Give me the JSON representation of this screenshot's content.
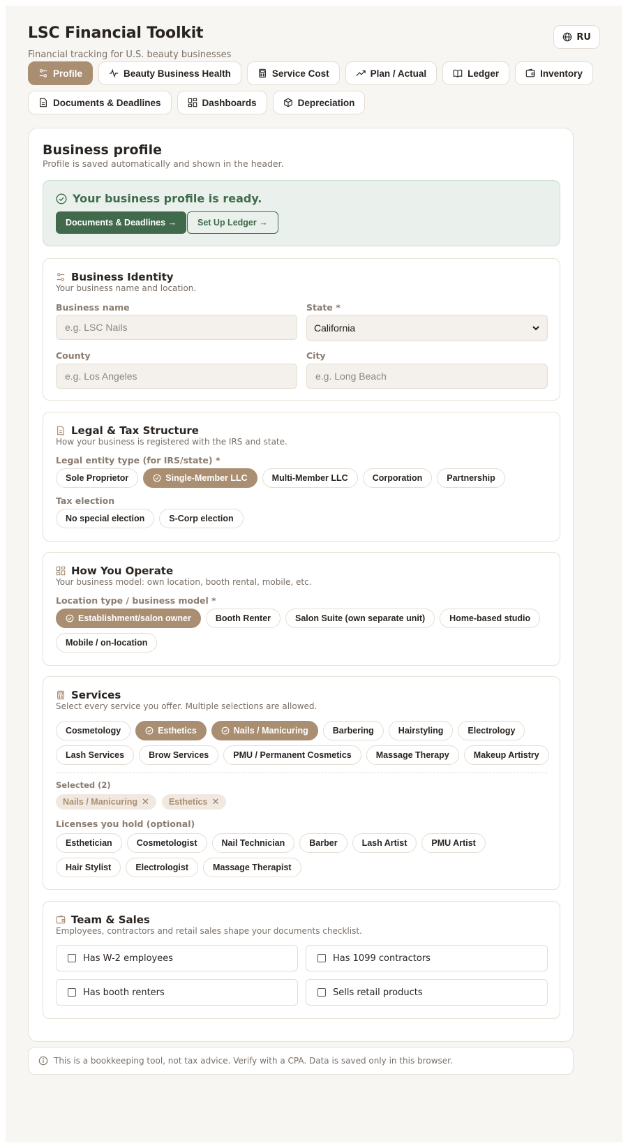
{
  "header": {
    "title": "LSC Financial Toolkit",
    "subtitle": "Financial tracking for U.S. beauty businesses",
    "lang_button": "RU"
  },
  "nav": {
    "row1": [
      {
        "label": "Profile",
        "icon": "sliders-icon",
        "active": true
      },
      {
        "label": "Beauty Business Health",
        "icon": "pulse-icon"
      },
      {
        "label": "Service Cost",
        "icon": "calculator-icon"
      },
      {
        "label": "Plan / Actual",
        "icon": "trending-up-icon"
      },
      {
        "label": "Ledger",
        "icon": "book-icon"
      },
      {
        "label": "Inventory",
        "icon": "wallet-icon"
      }
    ],
    "row2": [
      {
        "label": "Documents & Deadlines",
        "icon": "document-icon"
      },
      {
        "label": "Dashboards",
        "icon": "grid-icon"
      },
      {
        "label": "Depreciation",
        "icon": "box-icon"
      }
    ]
  },
  "profile": {
    "title": "Business profile",
    "subtitle": "Profile is saved automatically and shown in the header.",
    "ready_banner": {
      "text": "Your business profile is ready.",
      "primary_button": "Documents & Deadlines →",
      "secondary_button": "Set Up Ledger →"
    }
  },
  "identity": {
    "title": "Business Identity",
    "subtitle": "Your business name and location.",
    "business_name_label": "Business name",
    "business_name_placeholder": "e.g. LSC Nails",
    "business_name_value": "",
    "state_label": "State *",
    "state_value": "California",
    "county_label": "County",
    "county_placeholder": "e.g. Los Angeles",
    "county_value": "",
    "city_label": "City",
    "city_placeholder": "e.g. Long Beach",
    "city_value": ""
  },
  "legal": {
    "title": "Legal & Tax Structure",
    "subtitle": "How your business is registered with the IRS and state.",
    "entity_label": "Legal entity type (for IRS/state) *",
    "entity_options": [
      "Sole Proprietor",
      "Single-Member LLC",
      "Multi-Member LLC",
      "Corporation",
      "Partnership"
    ],
    "entity_selected": "Single-Member LLC",
    "tax_label": "Tax election",
    "tax_options": [
      "No special election",
      "S-Corp election"
    ]
  },
  "operate": {
    "title": "How You Operate",
    "subtitle": "Your business model: own location, booth rental, mobile, etc.",
    "location_label": "Location type / business model *",
    "location_options": [
      "Establishment/salon owner",
      "Booth Renter",
      "Salon Suite (own separate unit)",
      "Home-based studio",
      "Mobile / on-location"
    ],
    "location_selected": "Establishment/salon owner"
  },
  "services": {
    "title": "Services",
    "subtitle": "Select every service you offer. Multiple selections are allowed.",
    "options": [
      "Cosmetology",
      "Esthetics",
      "Nails / Manicuring",
      "Barbering",
      "Hairstyling",
      "Electrology",
      "Lash Services",
      "Brow Services",
      "PMU / Permanent Cosmetics",
      "Massage Therapy",
      "Makeup Artistry"
    ],
    "selected": [
      "Esthetics",
      "Nails / Manicuring"
    ],
    "selected_label": "Selected (2)",
    "selected_tags": [
      "Nails / Manicuring",
      "Esthetics"
    ],
    "licenses_label": "Licenses you hold (optional)",
    "licenses": [
      "Esthetician",
      "Cosmetologist",
      "Nail Technician",
      "Barber",
      "Lash Artist",
      "PMU Artist",
      "Hair Stylist",
      "Electrologist",
      "Massage Therapist"
    ]
  },
  "team": {
    "title": "Team & Sales",
    "subtitle": "Employees, contractors and retail sales shape your documents checklist.",
    "checks": [
      {
        "label": "Has W-2 employees",
        "checked": false
      },
      {
        "label": "Has 1099 contractors",
        "checked": false
      },
      {
        "label": "Has booth renters",
        "checked": false
      },
      {
        "label": "Sells retail products",
        "checked": false
      }
    ]
  },
  "footer": {
    "disclaimer": "This is a bookkeeping tool, not tax advice. Verify with a CPA. Data is saved only in this browser."
  },
  "colors": {
    "accent": "#a98e72",
    "success": "#416a4c",
    "background": "#f8f6f2"
  }
}
